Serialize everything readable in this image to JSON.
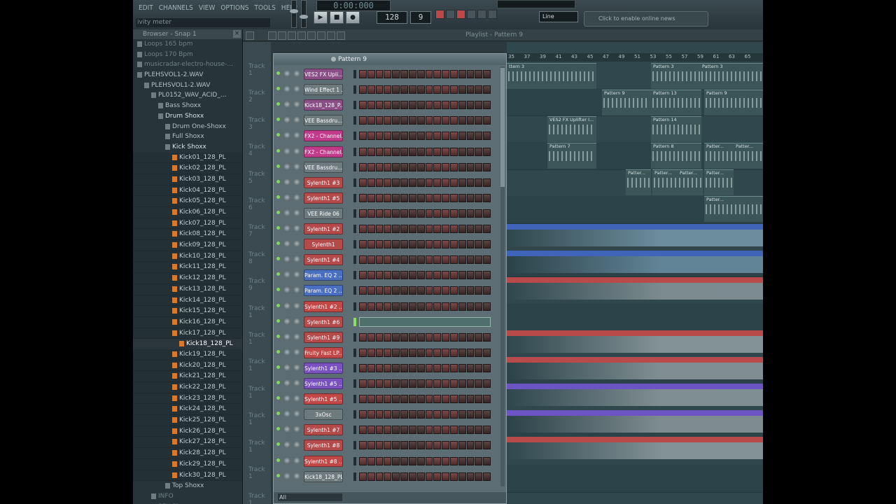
{
  "menu": [
    "EDIT",
    "CHANNELS",
    "VIEW",
    "OPTIONS",
    "TOOLS",
    "HELP"
  ],
  "hint_text": "ivity meter",
  "transport": {
    "time": "0:00:000",
    "play": "▶",
    "stop": "■",
    "record": "●",
    "tempo": "128",
    "pattern_number": "9",
    "snap": "Line",
    "news": "Click to enable online news"
  },
  "browser": {
    "title": "Browser - Snap 1",
    "items": [
      {
        "label": "Loops 165 bpm",
        "kind": "dim",
        "indent": 1
      },
      {
        "label": "Loops 170 Bpm",
        "kind": "dim",
        "indent": 1
      },
      {
        "label": "musicradar-electro-house-...",
        "kind": "dim",
        "indent": 1
      },
      {
        "label": "PLEHSVOL1-2.WAV",
        "kind": "folder",
        "indent": 1
      },
      {
        "label": "PLEHSVOL1-2.WAV",
        "kind": "folder",
        "indent": 2
      },
      {
        "label": "PL0152_WAV_ACID_...",
        "kind": "folder",
        "indent": 3
      },
      {
        "label": "Bass Shoxx",
        "kind": "folder",
        "indent": 4
      },
      {
        "label": "Drum Shoxx",
        "kind": "hl",
        "indent": 4
      },
      {
        "label": "Drum One-Shoxx",
        "kind": "folder",
        "indent": 5
      },
      {
        "label": "Full Shoxx",
        "kind": "folder",
        "indent": 5
      },
      {
        "label": "Kick Shoxx",
        "kind": "hl",
        "indent": 5
      },
      {
        "label": "Kick01_128_PL",
        "kind": "file",
        "indent": 6
      },
      {
        "label": "Kick02_128_PL",
        "kind": "file",
        "indent": 6
      },
      {
        "label": "Kick03_128_PL",
        "kind": "file",
        "indent": 6
      },
      {
        "label": "Kick04_128_PL",
        "kind": "file",
        "indent": 6
      },
      {
        "label": "Kick05_128_PL",
        "kind": "file",
        "indent": 6
      },
      {
        "label": "Kick06_128_PL",
        "kind": "file",
        "indent": 6
      },
      {
        "label": "Kick07_128_PL",
        "kind": "file",
        "indent": 6
      },
      {
        "label": "Kick08_128_PL",
        "kind": "file",
        "indent": 6
      },
      {
        "label": "Kick09_128_PL",
        "kind": "file",
        "indent": 6
      },
      {
        "label": "Kick10_128_PL",
        "kind": "file",
        "indent": 6
      },
      {
        "label": "Kick11_128_PL",
        "kind": "file",
        "indent": 6
      },
      {
        "label": "Kick12_128_PL",
        "kind": "file",
        "indent": 6
      },
      {
        "label": "Kick13_128_PL",
        "kind": "file",
        "indent": 6
      },
      {
        "label": "Kick14_128_PL",
        "kind": "file",
        "indent": 6
      },
      {
        "label": "Kick15_128_PL",
        "kind": "file",
        "indent": 6
      },
      {
        "label": "Kick16_128_PL",
        "kind": "file",
        "indent": 6
      },
      {
        "label": "Kick17_128_PL",
        "kind": "file",
        "indent": 6
      },
      {
        "label": "Kick18_128_PL",
        "kind": "sel",
        "indent": 7
      },
      {
        "label": "Kick19_128_PL",
        "kind": "file",
        "indent": 6
      },
      {
        "label": "Kick20_128_PL",
        "kind": "file",
        "indent": 6
      },
      {
        "label": "Kick21_128_PL",
        "kind": "file",
        "indent": 6
      },
      {
        "label": "Kick22_128_PL",
        "kind": "file",
        "indent": 6
      },
      {
        "label": "Kick23_128_PL",
        "kind": "file",
        "indent": 6
      },
      {
        "label": "Kick24_128_PL",
        "kind": "file",
        "indent": 6
      },
      {
        "label": "Kick25_128_PL",
        "kind": "file",
        "indent": 6
      },
      {
        "label": "Kick26_128_PL",
        "kind": "file",
        "indent": 6
      },
      {
        "label": "Kick27_128_PL",
        "kind": "file",
        "indent": 6
      },
      {
        "label": "Kick28_128_PL",
        "kind": "file",
        "indent": 6
      },
      {
        "label": "Kick29_128_PL",
        "kind": "file",
        "indent": 6
      },
      {
        "label": "Kick30_128_PL",
        "kind": "file",
        "indent": 6
      },
      {
        "label": "Top Shoxx",
        "kind": "folder",
        "indent": 5
      },
      {
        "label": "INFO",
        "kind": "dim",
        "indent": 3
      },
      {
        "label": "SFX Shoxx",
        "kind": "dim",
        "indent": 3
      }
    ]
  },
  "playlist": {
    "title": "Playlist - Pattern 9",
    "tracks": [
      "Track 1",
      "Track 2",
      "Track 3",
      "Track 4",
      "Track 5",
      "Track 6",
      "Track 7",
      "Track 8",
      "Track 9",
      "Track 1",
      "Track 1",
      "Track 1",
      "Track 1",
      "Track 1",
      "Track 1",
      "Track 1",
      "Track 1"
    ],
    "ruler": [
      "35",
      "37",
      "39",
      "41",
      "43",
      "45",
      "47",
      "49",
      "51",
      "53",
      "55",
      "57",
      "59",
      "61",
      "63",
      "65"
    ],
    "clips": [
      {
        "label": "ttern 3"
      },
      {
        "label": "Pattern 3"
      },
      {
        "label": "Pattern 3"
      },
      {
        "label": "Pattern 9"
      },
      {
        "label": "Pattern 13"
      },
      {
        "label": "Pattern 9"
      },
      {
        "label": "VES2 FX Uplifter I..."
      },
      {
        "label": "Pattern 14"
      },
      {
        "label": "Pattern 7"
      },
      {
        "label": "Pattern 8"
      },
      {
        "label": "Patter..."
      },
      {
        "label": "Patter..."
      },
      {
        "label": "Patter..."
      },
      {
        "label": "Patter..."
      },
      {
        "label": "Patter..."
      },
      {
        "label": "Patter..."
      },
      {
        "label": "Patter..."
      }
    ]
  },
  "stepseq": {
    "pattern": "Pattern 9",
    "filter": "All",
    "channels": [
      {
        "label": "VES2 FX Upli...",
        "color": "#8a4f86"
      },
      {
        "label": "Wind Effect 1 ...",
        "color": "#6d7a7e"
      },
      {
        "label": "Kick18_128_P...",
        "color": "#8a4f86"
      },
      {
        "label": "VEE Bassdru...",
        "color": "#6d7a7e"
      },
      {
        "label": "FX2 - Channel...",
        "color": "#c23a8a"
      },
      {
        "label": "FX2 - Channel...",
        "color": "#c23a8a"
      },
      {
        "label": "VEE Bassdru...",
        "color": "#6d7a7e"
      },
      {
        "label": "Sylenth1 #3",
        "color": "#b54a4a"
      },
      {
        "label": "Sylenth1 #5",
        "color": "#b54a4a"
      },
      {
        "label": "VEE Ride 06",
        "color": "#6d7a7e"
      },
      {
        "label": "Sylenth1 #2",
        "color": "#b54a4a"
      },
      {
        "label": "Sylenth1",
        "color": "#b54a4a"
      },
      {
        "label": "Sylenth1 #4",
        "color": "#b54a4a"
      },
      {
        "label": "Param. EQ 2 ...",
        "color": "#4a6fc0"
      },
      {
        "label": "Param. EQ 2 ...",
        "color": "#4a6fc0"
      },
      {
        "label": "Sylenth1 #2 ...",
        "color": "#c24848"
      },
      {
        "label": "Sylenth1 #6",
        "color": "#b54a4a"
      },
      {
        "label": "Sylenth1 #9",
        "color": "#b54a4a"
      },
      {
        "label": "Fruity Fast LP...",
        "color": "#c24848"
      },
      {
        "label": "Sylenth1 #3 ...",
        "color": "#7a52c0"
      },
      {
        "label": "Sylenth1 #5 ...",
        "color": "#7a52c0"
      },
      {
        "label": "Sylenth1 #5 ...",
        "color": "#c24848"
      },
      {
        "label": "3xOsc",
        "color": "#6d7a7e"
      },
      {
        "label": "Sylenth1 #7",
        "color": "#b54a4a"
      },
      {
        "label": "Sylenth1 #8",
        "color": "#b54a4a"
      },
      {
        "label": "Sylenth1 #8 ...",
        "color": "#c24848"
      },
      {
        "label": "Kick18_128_PL",
        "color": "#6d7a7e"
      }
    ]
  }
}
